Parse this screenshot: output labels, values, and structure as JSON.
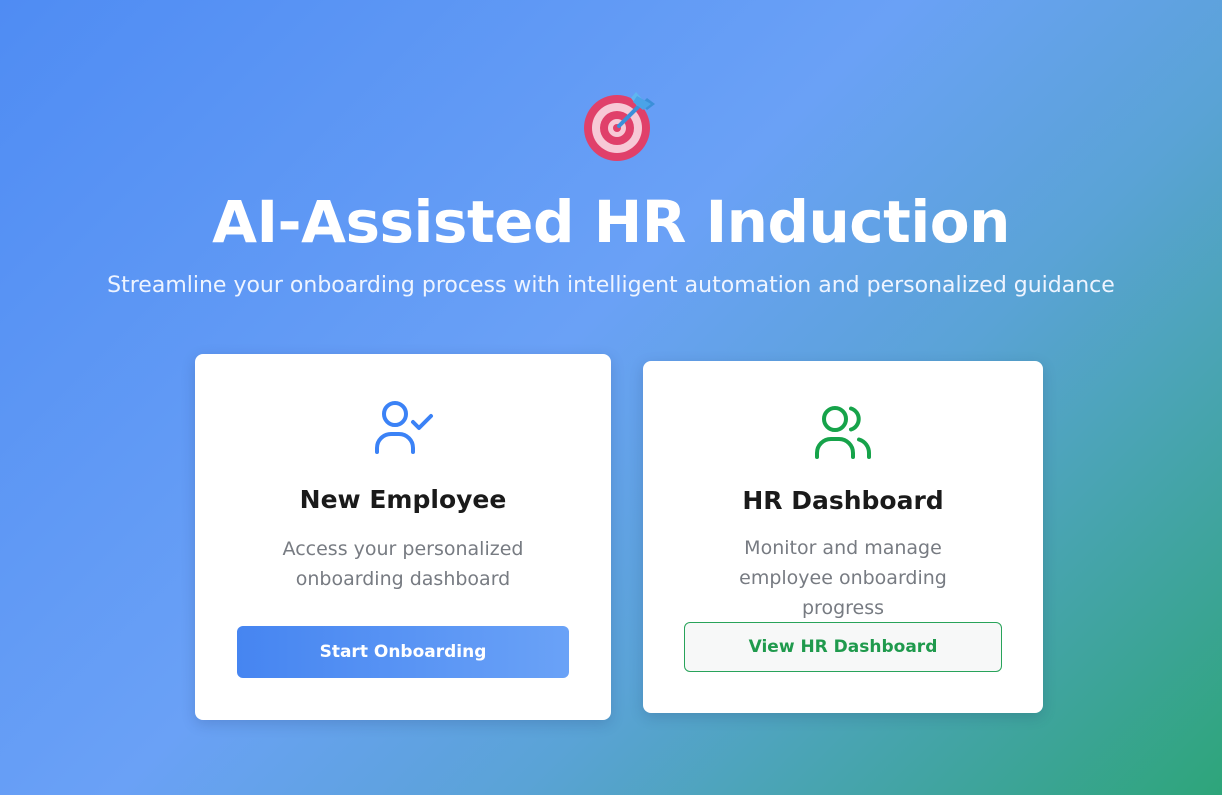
{
  "hero": {
    "logo_icon": "target-dart-icon",
    "title": "AI-Assisted HR Induction",
    "subtitle": "Streamline your onboarding process with intelligent automation and personalized guidance"
  },
  "cards": {
    "employee": {
      "icon": "user-check-icon",
      "icon_color": "#3b82f6",
      "title": "New Employee",
      "description": "Access your personalized onboarding dashboard",
      "button_label": "Start Onboarding"
    },
    "hr": {
      "icon": "users-icon",
      "icon_color": "#16a34a",
      "title": "HR Dashboard",
      "description": "Monitor and manage employee onboarding progress",
      "button_label": "View HR Dashboard"
    }
  },
  "colors": {
    "gradient_start": "#4f8cf3",
    "gradient_end": "#2ea57a",
    "primary_button": "#4685f1",
    "outline_button": "#28a35a"
  }
}
